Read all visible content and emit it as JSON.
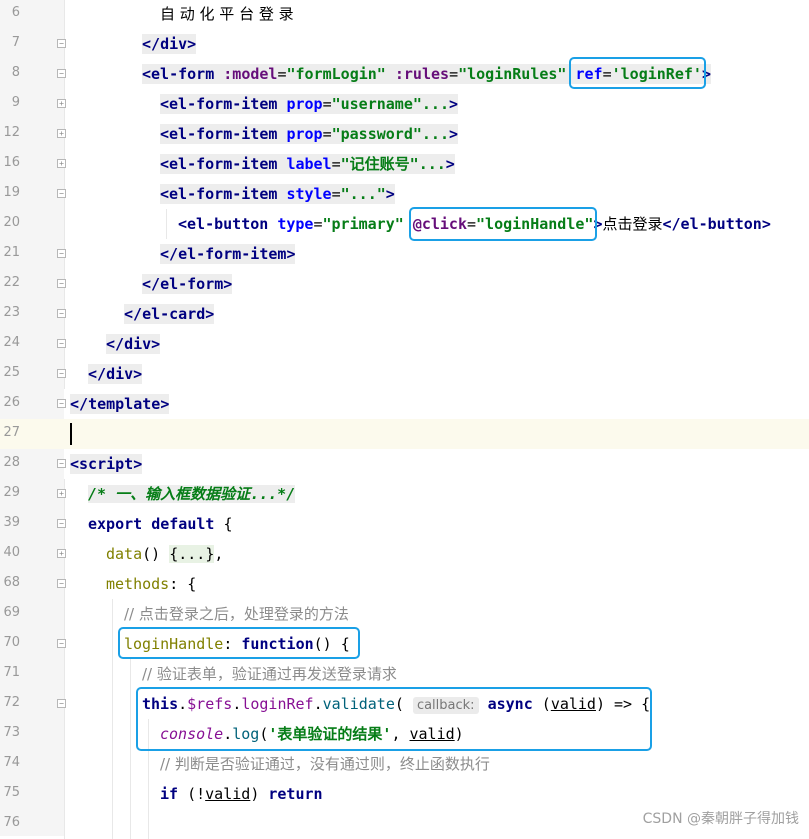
{
  "lines": [
    {
      "n": "6",
      "fold": "",
      "guides": [
        64
      ],
      "indent": 160,
      "hl": false,
      "tokens": [
        {
          "t": "自 动 化 平 台 登 录",
          "c": "plain cjk"
        }
      ]
    },
    {
      "n": "7",
      "fold": "−",
      "guides": [
        64
      ],
      "indent": 142,
      "hl": true,
      "tokens": [
        {
          "t": "</",
          "c": "tag"
        },
        {
          "t": "div",
          "c": "tag"
        },
        {
          "t": ">",
          "c": "tag"
        }
      ]
    },
    {
      "n": "8",
      "fold": "−",
      "guides": [
        64
      ],
      "indent": 142,
      "hl": true,
      "tokens": [
        {
          "t": "<el-form ",
          "c": "tag"
        },
        {
          "t": ":model",
          "c": "bind"
        },
        {
          "t": "=",
          "c": "plain"
        },
        {
          "t": "\"formLogin\"",
          "c": "str"
        },
        {
          "t": " ",
          "c": "plain"
        },
        {
          "t": ":rules",
          "c": "bind"
        },
        {
          "t": "=",
          "c": "plain"
        },
        {
          "t": "\"loginRules\"",
          "c": "str"
        },
        {
          "t": " ",
          "c": "plain"
        },
        {
          "t": "ref",
          "c": "attr"
        },
        {
          "t": "=",
          "c": "plain"
        },
        {
          "t": "'loginRef'",
          "c": "str"
        },
        {
          "t": ">",
          "c": "tag"
        }
      ]
    },
    {
      "n": "9",
      "fold": "+",
      "guides": [
        64
      ],
      "indent": 160,
      "hl": true,
      "tokens": [
        {
          "t": "<el-form-item ",
          "c": "tag"
        },
        {
          "t": "prop",
          "c": "attr"
        },
        {
          "t": "=",
          "c": "plain"
        },
        {
          "t": "\"username\"",
          "c": "str"
        },
        {
          "t": "...",
          "c": "str"
        },
        {
          "t": ">",
          "c": "tag"
        }
      ]
    },
    {
      "n": "12",
      "fold": "+",
      "guides": [
        64
      ],
      "indent": 160,
      "hl": true,
      "tokens": [
        {
          "t": "<el-form-item ",
          "c": "tag"
        },
        {
          "t": "prop",
          "c": "attr"
        },
        {
          "t": "=",
          "c": "plain"
        },
        {
          "t": "\"password\"",
          "c": "str"
        },
        {
          "t": "...",
          "c": "str"
        },
        {
          "t": ">",
          "c": "tag"
        }
      ]
    },
    {
      "n": "16",
      "fold": "+",
      "guides": [
        64
      ],
      "indent": 160,
      "hl": true,
      "tokens": [
        {
          "t": "<el-form-item ",
          "c": "tag"
        },
        {
          "t": "label",
          "c": "attr"
        },
        {
          "t": "=",
          "c": "plain"
        },
        {
          "t": "\"记住账号\"",
          "c": "str"
        },
        {
          "t": "...",
          "c": "str"
        },
        {
          "t": ">",
          "c": "tag"
        }
      ]
    },
    {
      "n": "19",
      "fold": "−",
      "guides": [
        64
      ],
      "indent": 160,
      "hl": true,
      "tokens": [
        {
          "t": "<el-form-item ",
          "c": "tag"
        },
        {
          "t": "style",
          "c": "attr"
        },
        {
          "t": "=",
          "c": "plain"
        },
        {
          "t": "\"...\"",
          "c": "str"
        },
        {
          "t": ">",
          "c": "tag"
        }
      ]
    },
    {
      "n": "20",
      "fold": "",
      "guides": [
        64,
        166
      ],
      "indent": 178,
      "hl": false,
      "tokens": [
        {
          "t": "<el-button ",
          "c": "tag"
        },
        {
          "t": "type",
          "c": "attr"
        },
        {
          "t": "=",
          "c": "plain"
        },
        {
          "t": "\"primary\"",
          "c": "str"
        },
        {
          "t": " ",
          "c": "plain"
        },
        {
          "t": "@click",
          "c": "bind"
        },
        {
          "t": "=",
          "c": "plain"
        },
        {
          "t": "\"loginHandle\"",
          "c": "str"
        },
        {
          "t": ">",
          "c": "tag"
        },
        {
          "t": "点击登录",
          "c": "plain cjk"
        },
        {
          "t": "</",
          "c": "tag"
        },
        {
          "t": "el-button",
          "c": "tag"
        },
        {
          "t": ">",
          "c": "tag"
        }
      ]
    },
    {
      "n": "21",
      "fold": "−",
      "guides": [
        64
      ],
      "indent": 160,
      "hl": true,
      "tokens": [
        {
          "t": "</",
          "c": "tag"
        },
        {
          "t": "el-form-item",
          "c": "tag"
        },
        {
          "t": ">",
          "c": "tag"
        }
      ]
    },
    {
      "n": "22",
      "fold": "−",
      "guides": [
        64
      ],
      "indent": 142,
      "hl": true,
      "tokens": [
        {
          "t": "</",
          "c": "tag"
        },
        {
          "t": "el-form",
          "c": "tag"
        },
        {
          "t": ">",
          "c": "tag"
        }
      ]
    },
    {
      "n": "23",
      "fold": "−",
      "guides": [
        64
      ],
      "indent": 124,
      "hl": true,
      "tokens": [
        {
          "t": "</",
          "c": "tag"
        },
        {
          "t": "el-card",
          "c": "tag"
        },
        {
          "t": ">",
          "c": "tag"
        }
      ]
    },
    {
      "n": "24",
      "fold": "−",
      "guides": [
        64
      ],
      "indent": 106,
      "hl": true,
      "tokens": [
        {
          "t": "</",
          "c": "tag"
        },
        {
          "t": "div",
          "c": "tag"
        },
        {
          "t": ">",
          "c": "tag"
        }
      ]
    },
    {
      "n": "25",
      "fold": "−",
      "guides": [
        64
      ],
      "indent": 88,
      "hl": true,
      "tokens": [
        {
          "t": "</",
          "c": "tag"
        },
        {
          "t": "div",
          "c": "tag"
        },
        {
          "t": ">",
          "c": "tag"
        }
      ]
    },
    {
      "n": "26",
      "fold": "−",
      "guides": [],
      "indent": 70,
      "hl": true,
      "tokens": [
        {
          "t": "</",
          "c": "tag"
        },
        {
          "t": "template",
          "c": "tag"
        },
        {
          "t": ">",
          "c": "tag"
        }
      ]
    },
    {
      "n": "27",
      "fold": "",
      "guides": [],
      "indent": 70,
      "hl": false,
      "current": true,
      "tokens": []
    },
    {
      "n": "28",
      "fold": "−",
      "guides": [],
      "indent": 70,
      "hl": true,
      "tokens": [
        {
          "t": "<",
          "c": "tag"
        },
        {
          "t": "script",
          "c": "tag"
        },
        {
          "t": ">",
          "c": "tag"
        }
      ]
    },
    {
      "n": "29",
      "fold": "+",
      "guides": [
        64
      ],
      "indent": 88,
      "hl": false,
      "tokens": [
        {
          "t": "/* 一、输入框数据验证...*/",
          "c": "cmt-fold"
        }
      ]
    },
    {
      "n": "39",
      "fold": "−",
      "guides": [
        64
      ],
      "indent": 88,
      "hl": false,
      "tokens": [
        {
          "t": "export default ",
          "c": "kw"
        },
        {
          "t": "{",
          "c": "plain"
        }
      ]
    },
    {
      "n": "40",
      "fold": "+",
      "guides": [
        64
      ],
      "indent": 106,
      "hl": false,
      "tokens": [
        {
          "t": "data",
          "c": "data"
        },
        {
          "t": "() ",
          "c": "plain"
        },
        {
          "t": "{...}",
          "c": "fold-ph"
        },
        {
          "t": ",",
          "c": "plain"
        }
      ]
    },
    {
      "n": "68",
      "fold": "−",
      "guides": [
        64
      ],
      "indent": 106,
      "hl": false,
      "tokens": [
        {
          "t": "methods",
          "c": "data"
        },
        {
          "t": ": {",
          "c": "plain"
        }
      ]
    },
    {
      "n": "69",
      "fold": "",
      "guides": [
        64,
        112
      ],
      "indent": 124,
      "hl": false,
      "tokens": [
        {
          "t": "// 点击登录之后，处理登录的方法",
          "c": "cmt2"
        }
      ]
    },
    {
      "n": "70",
      "fold": "−",
      "guides": [
        64,
        112
      ],
      "indent": 124,
      "hl": false,
      "tokens": [
        {
          "t": "loginHandle",
          "c": "data"
        },
        {
          "t": ": ",
          "c": "plain"
        },
        {
          "t": "function",
          "c": "kw"
        },
        {
          "t": "() {",
          "c": "plain"
        }
      ]
    },
    {
      "n": "71",
      "fold": "",
      "guides": [
        64,
        112,
        130
      ],
      "indent": 142,
      "hl": false,
      "tokens": [
        {
          "t": "// 验证表单，验证通过再发送登录请求",
          "c": "cmt2"
        }
      ]
    },
    {
      "n": "72",
      "fold": "−",
      "guides": [
        64,
        112,
        130
      ],
      "indent": 142,
      "hl": false,
      "tokens": [
        {
          "t": "this",
          "c": "kw"
        },
        {
          "t": ".",
          "c": "plain"
        },
        {
          "t": "$refs",
          "c": "purple"
        },
        {
          "t": ".",
          "c": "plain"
        },
        {
          "t": "loginRef",
          "c": "purple"
        },
        {
          "t": ".",
          "c": "plain"
        },
        {
          "t": "validate",
          "c": "fn"
        },
        {
          "t": "( ",
          "c": "plain"
        },
        {
          "t": "callback:",
          "c": "hint"
        },
        {
          "t": " async ",
          "c": "kw"
        },
        {
          "t": "(",
          "c": "plain"
        },
        {
          "t": "valid",
          "c": "plain under"
        },
        {
          "t": ") => {",
          "c": "plain"
        }
      ]
    },
    {
      "n": "73",
      "fold": "",
      "guides": [
        64,
        112,
        130,
        148
      ],
      "indent": 160,
      "hl": false,
      "tokens": [
        {
          "t": "console",
          "c": "ital"
        },
        {
          "t": ".",
          "c": "plain"
        },
        {
          "t": "log",
          "c": "fn"
        },
        {
          "t": "(",
          "c": "plain"
        },
        {
          "t": "'表单验证的结果'",
          "c": "str"
        },
        {
          "t": ", ",
          "c": "plain"
        },
        {
          "t": "valid",
          "c": "plain under"
        },
        {
          "t": ")",
          "c": "plain"
        }
      ]
    },
    {
      "n": "74",
      "fold": "",
      "guides": [
        64,
        112,
        130,
        148
      ],
      "indent": 160,
      "hl": false,
      "tokens": [
        {
          "t": "// 判断是否验证通过，没有通过则，终止函数执行",
          "c": "cmt2"
        }
      ]
    },
    {
      "n": "75",
      "fold": "",
      "guides": [
        64,
        112,
        130,
        148
      ],
      "indent": 160,
      "hl": false,
      "tokens": [
        {
          "t": "if ",
          "c": "kw"
        },
        {
          "t": "(!",
          "c": "plain"
        },
        {
          "t": "valid",
          "c": "plain under"
        },
        {
          "t": ") ",
          "c": "plain"
        },
        {
          "t": "return",
          "c": "kw"
        }
      ]
    },
    {
      "n": "76",
      "fold": "",
      "guides": [
        64,
        112,
        130,
        148
      ],
      "indent": 160,
      "hl": false,
      "tokens": []
    }
  ],
  "watermark": "CSDN @秦朝胖子得加钱"
}
